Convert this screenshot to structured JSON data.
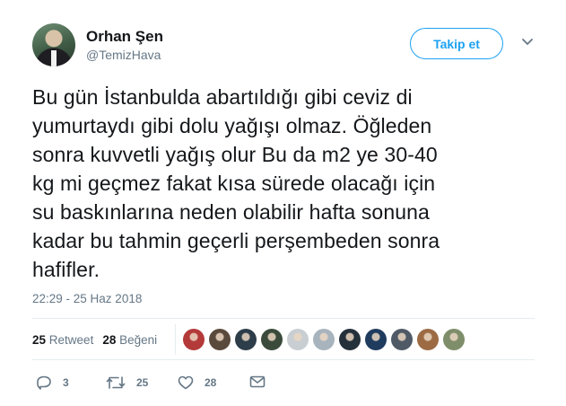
{
  "user": {
    "name": "Orhan Şen",
    "handle": "@TemizHava",
    "avatar_icon": "profile-photo"
  },
  "follow_button": {
    "label": "Takip et"
  },
  "tweet": {
    "lines": [
      "Bu gün İstanbulda abartıldığı gibi ceviz di",
      "yumurtaydı gibi dolu yağışı olmaz. Öğleden",
      "sonra kuvvetli yağış olur Bu da m2 ye 30-40",
      "kg mi geçmez fakat kısa sürede olacağı için",
      "su baskınlarına neden olabilir hafta sonuna",
      "kadar bu tahmin geçerli perşembeden sonra",
      "hafifler."
    ],
    "timestamp": "22:29 - 25 Haz 2018"
  },
  "stats": {
    "retweet_count": "25",
    "retweet_label": "Retweet",
    "like_count": "28",
    "like_label": "Beğeni"
  },
  "likers": [
    {
      "color": "#b43a3a"
    },
    {
      "color": "#5a4a3c"
    },
    {
      "color": "#2d3d4a"
    },
    {
      "color": "#3b4b3b"
    },
    {
      "color": "#c9ced3"
    },
    {
      "color": "#a8b4bd"
    },
    {
      "color": "#24303a"
    },
    {
      "color": "#1f3b5e"
    },
    {
      "color": "#4f5a66"
    },
    {
      "color": "#9c6b44"
    },
    {
      "color": "#7f8e6a"
    }
  ],
  "actions": {
    "reply_count": "3",
    "retweet_count": "25",
    "like_count": "28"
  },
  "colors": {
    "accent": "#1da1f2",
    "secondary_text": "#657786",
    "divider": "#e6ecf0"
  }
}
